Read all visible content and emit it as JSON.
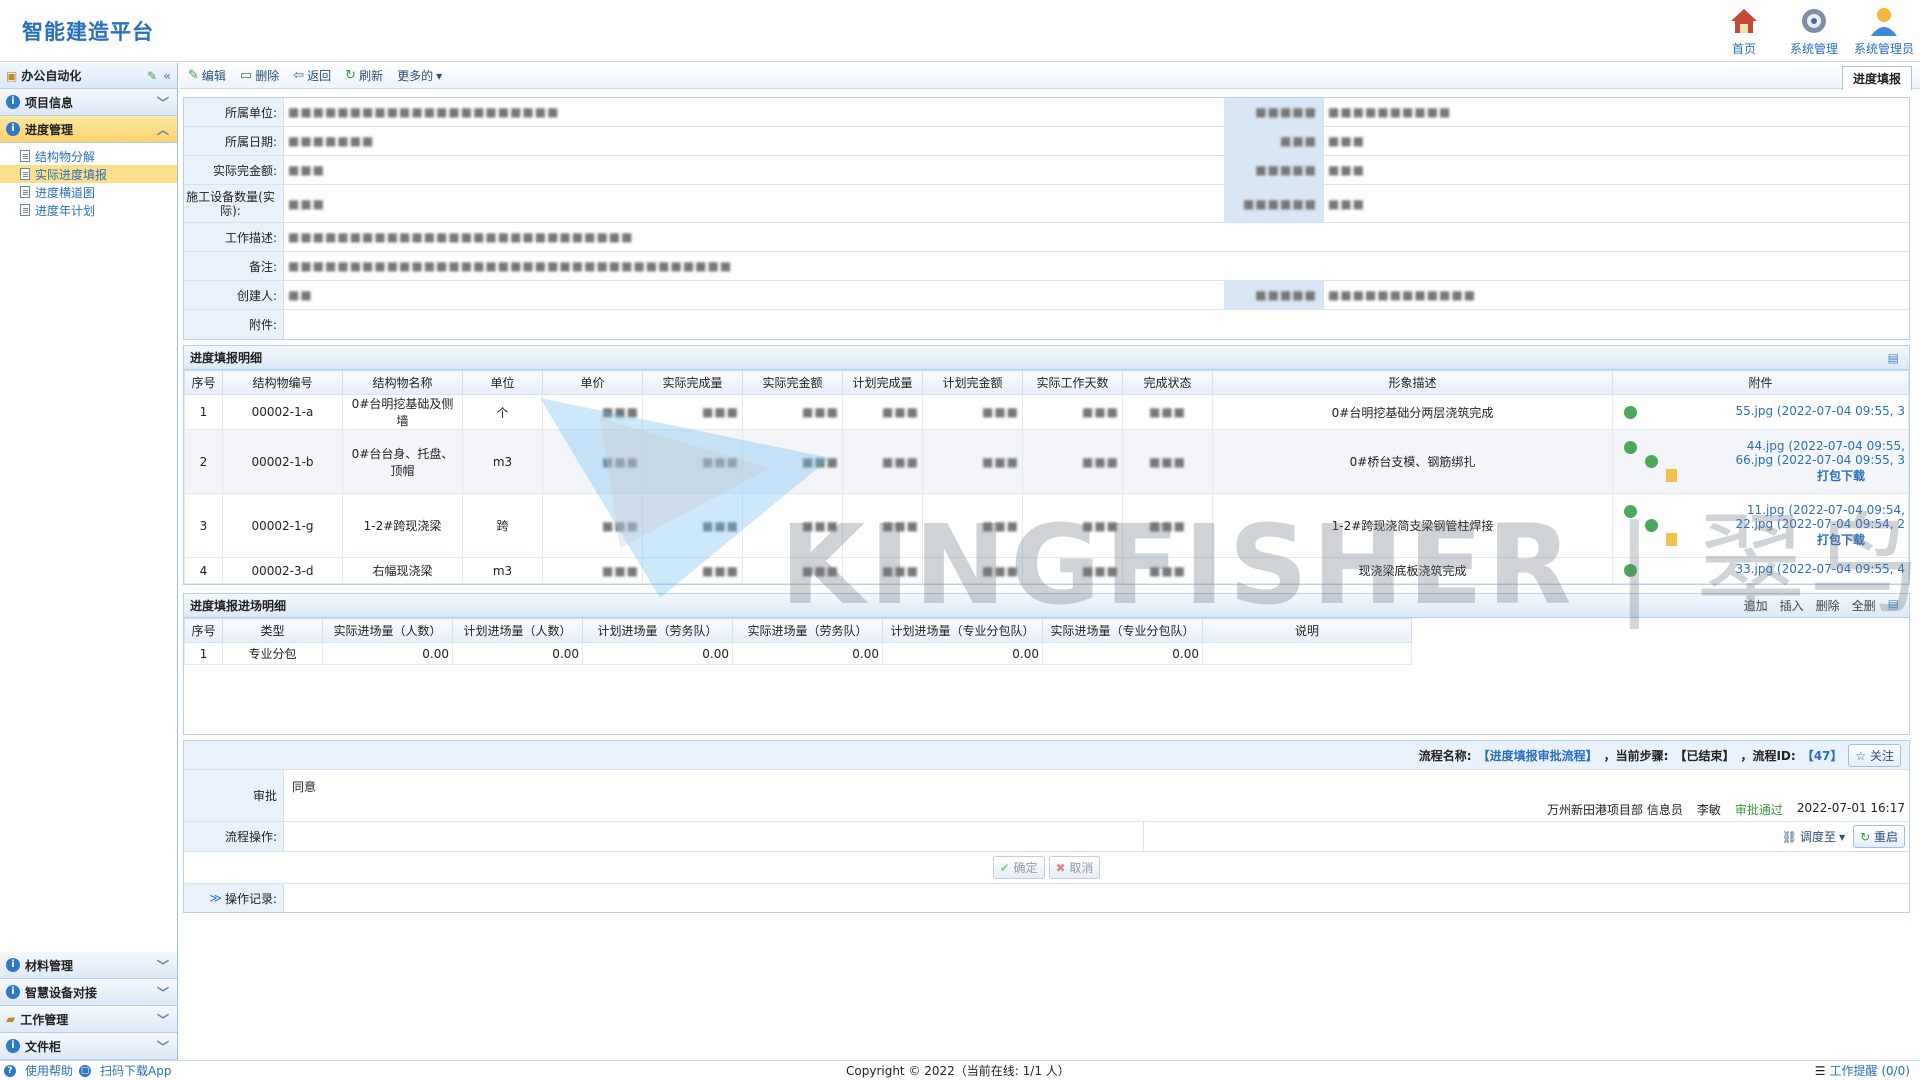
{
  "app": {
    "title": "智能建造平台"
  },
  "topnav": [
    {
      "label": "首页",
      "icon": "home-icon"
    },
    {
      "label": "系统管理",
      "icon": "gear-icon"
    },
    {
      "label": "系统管理员",
      "icon": "user-icon"
    }
  ],
  "sidebar": {
    "header": "办公自动化",
    "sections_top": [
      {
        "label": "项目信息"
      },
      {
        "label": "进度管理"
      }
    ],
    "sub_items": [
      "结构物分解",
      "实际进度填报",
      "进度横道图",
      "进度年计划"
    ],
    "sections_bottom": [
      "材料管理",
      "智慧设备对接",
      "工作管理",
      "文件柜"
    ]
  },
  "toolbar": {
    "edit": "编辑",
    "delete": "删除",
    "back": "返回",
    "refresh": "刷新",
    "more": "更多的"
  },
  "active_tab": "进度填报",
  "form": {
    "unit_label": "所属单位:",
    "date_label": "所属日期:",
    "actual_amount_label": "实际完金额:",
    "equip_label": "施工设备数量(实际):",
    "work_desc_label": "工作描述:",
    "remark_label": "备注:",
    "creator_label": "创建人:",
    "attachment_label": "附件:"
  },
  "detail": {
    "title": "进度填报明细",
    "headers": [
      "序号",
      "结构物编号",
      "结构物名称",
      "单位",
      "单价",
      "实际完成量",
      "实际完金额",
      "计划完成量",
      "计划完金额",
      "实际工作天数",
      "完成状态",
      "形象描述",
      "附件"
    ],
    "rows": [
      {
        "no": "1",
        "code": "00002-1-a",
        "name": "0#台明挖基础及侧墙",
        "unit": "个",
        "desc": "0#台明挖基础分两层浇筑完成",
        "files": [
          "55.jpg (2022-07-04 09:55, 3"
        ]
      },
      {
        "no": "2",
        "code": "00002-1-b",
        "name": "0#台台身、托盘、顶帽",
        "unit": "m3",
        "desc": "0#桥台支模、钢筋绑扎",
        "files": [
          "44.jpg (2022-07-04 09:55,",
          "66.jpg (2022-07-04 09:55, 3"
        ],
        "download": "打包下载"
      },
      {
        "no": "3",
        "code": "00002-1-g",
        "name": "1-2#跨现浇梁",
        "unit": "跨",
        "desc": "1-2#跨现浇简支梁钢管柱焊接",
        "files": [
          "11.jpg (2022-07-04 09:54,",
          "22.jpg (2022-07-04 09:54, 2"
        ],
        "download": "打包下载"
      },
      {
        "no": "4",
        "code": "00002-3-d",
        "name": "右幅现浇梁",
        "unit": "m3",
        "desc": "现浇梁底板浇筑完成",
        "files": [
          "33.jpg (2022-07-04 09:55, 4"
        ]
      }
    ]
  },
  "entry": {
    "title": "进度填报进场明细",
    "tools": [
      "追加",
      "插入",
      "删除",
      "全删"
    ],
    "headers": [
      "序号",
      "类型",
      "实际进场量（人数）",
      "计划进场量（人数）",
      "计划进场量（劳务队）",
      "实际进场量（劳务队）",
      "计划进场量（专业分包队）",
      "实际进场量（专业分包队）",
      "说明"
    ],
    "rows": [
      {
        "no": "1",
        "type": "专业分包",
        "v1": "0.00",
        "v2": "0.00",
        "v3": "0.00",
        "v4": "0.00",
        "v5": "0.00",
        "v6": "0.00",
        "note": ""
      }
    ]
  },
  "flow": {
    "name_label": "流程名称:",
    "name": "【进度填报审批流程】",
    "step_label": "，当前步骤:",
    "step": "【已结束】",
    "id_label": "，流程ID:",
    "id": "【47】",
    "follow": "关注",
    "approve_label": "审批",
    "approve_text": "同意",
    "approver_info": "万州新田港项目部 信息员",
    "approver": "李敏",
    "approve_status": "审批通过",
    "approve_time": "2022-07-01 16:17",
    "op_label": "流程操作:",
    "dispatch": "调度至",
    "restart": "重启",
    "confirm": "确定",
    "cancel": "取消",
    "log_label": "操作记录:"
  },
  "watermark": {
    "en": "KINGFISHER",
    "cn": "翠鸟"
  },
  "footer": {
    "help": "使用帮助",
    "app": "扫码下载App",
    "copyright": "Copyright © 2022（当前在线: 1/1 人）",
    "reminder": "工作提醒 (0/0)"
  }
}
